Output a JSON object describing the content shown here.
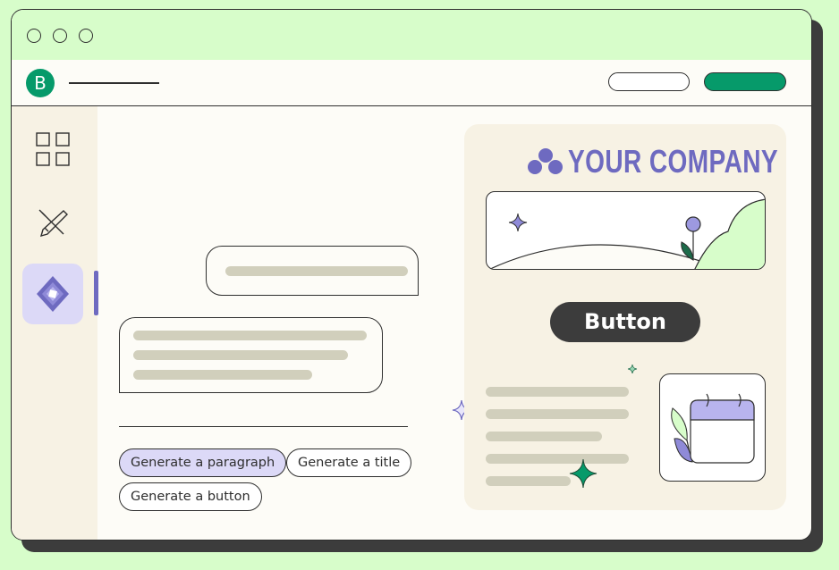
{
  "colors": {
    "background": "#d7fdca",
    "accent_green": "#069a6a",
    "accent_purple": "#6e6ac0",
    "lavender": "#dcd9f7",
    "cream": "#f7f2e4",
    "placeholder_bar": "#d1cfbc",
    "dark": "#3c3c3c"
  },
  "app": {
    "logo_letter": "B"
  },
  "sidebar": {
    "items": [
      {
        "icon": "grid-icon"
      },
      {
        "icon": "pencil-icon"
      },
      {
        "icon": "ai-sparkle-icon",
        "active": true
      }
    ]
  },
  "chat": {
    "suggestions": [
      "Generate a paragraph",
      "Generate a title",
      "Generate a button"
    ]
  },
  "preview": {
    "company_name": "YOUR COMPANY",
    "button_label": "Button"
  }
}
